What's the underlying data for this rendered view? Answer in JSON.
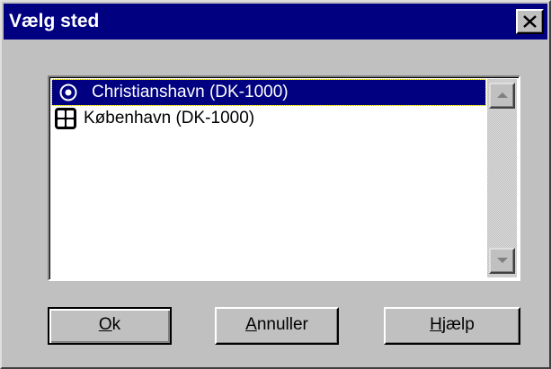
{
  "window": {
    "title": "Vælg sted",
    "close_symbol": "✕"
  },
  "list": {
    "items": [
      {
        "label": "Christianshavn (DK-1000)",
        "icon": "target-circle-icon",
        "selected": true
      },
      {
        "label": "København (DK-1000)",
        "icon": "grid-window-icon",
        "selected": false
      }
    ]
  },
  "buttons": {
    "ok": {
      "accel": "O",
      "rest": "k"
    },
    "cancel": {
      "accel": "A",
      "rest": "nnuller"
    },
    "help": {
      "accel": "H",
      "rest": "jælp"
    }
  },
  "colors": {
    "titlebar": "#000080",
    "face": "#c0c0c0",
    "selection": "#000080"
  }
}
